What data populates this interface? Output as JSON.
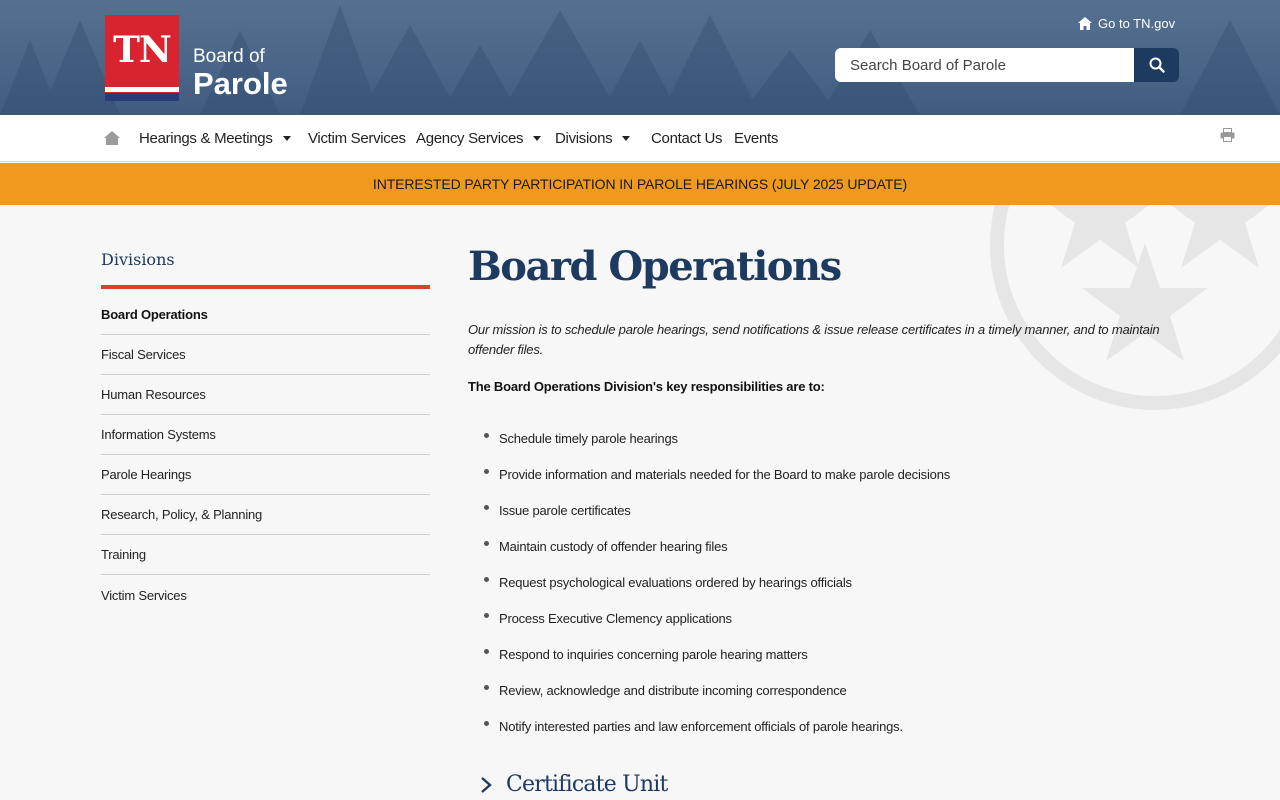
{
  "header": {
    "logo_abbr": "TN",
    "logo_line1": "Board of",
    "logo_line2": "Parole",
    "go_link": "Go to TN.gov",
    "search_placeholder": "Search Board of Parole"
  },
  "nav": {
    "items": [
      {
        "label": "Hearings & Meetings",
        "dropdown": true
      },
      {
        "label": "Victim Services",
        "dropdown": false
      },
      {
        "label": "Agency Services",
        "dropdown": true
      },
      {
        "label": "Divisions",
        "dropdown": true
      },
      {
        "label": "Contact Us",
        "dropdown": false
      },
      {
        "label": "Events",
        "dropdown": false
      }
    ]
  },
  "banner": {
    "text": "INTERESTED PARTY PARTICIPATION IN PAROLE HEARINGS (JULY 2025 UPDATE)"
  },
  "sidebar": {
    "title": "Divisions",
    "items": [
      "Board Operations",
      "Fiscal Services",
      "Human Resources",
      "Information Systems",
      "Parole Hearings",
      "Research, Policy, & Planning",
      "Training",
      "Victim Services"
    ],
    "active_index": 0
  },
  "main": {
    "title": "Board Operations",
    "mission": "Our mission is to schedule parole hearings, send notifications & issue release certificates in a timely manner, and to maintain offender files.",
    "key_heading": "The Board Operations Division's key responsibilities are to:",
    "responsibilities": [
      "Schedule timely parole hearings",
      "Provide information and materials needed for the Board to make parole decisions",
      "Issue parole certificates",
      "Maintain custody of offender hearing files",
      "Request psychological evaluations ordered by hearings officials",
      "Process Executive Clemency applications",
      "Respond to inquiries concerning parole hearing matters",
      "Review, acknowledge and distribute incoming correspondence",
      "Notify interested parties and law enforcement officials of parole hearings."
    ],
    "section": "Certificate Unit"
  },
  "colors": {
    "navy": "#1d3a60",
    "banner": "#f0991f",
    "red": "#d9232e",
    "accent_rule": "#d9412e"
  }
}
